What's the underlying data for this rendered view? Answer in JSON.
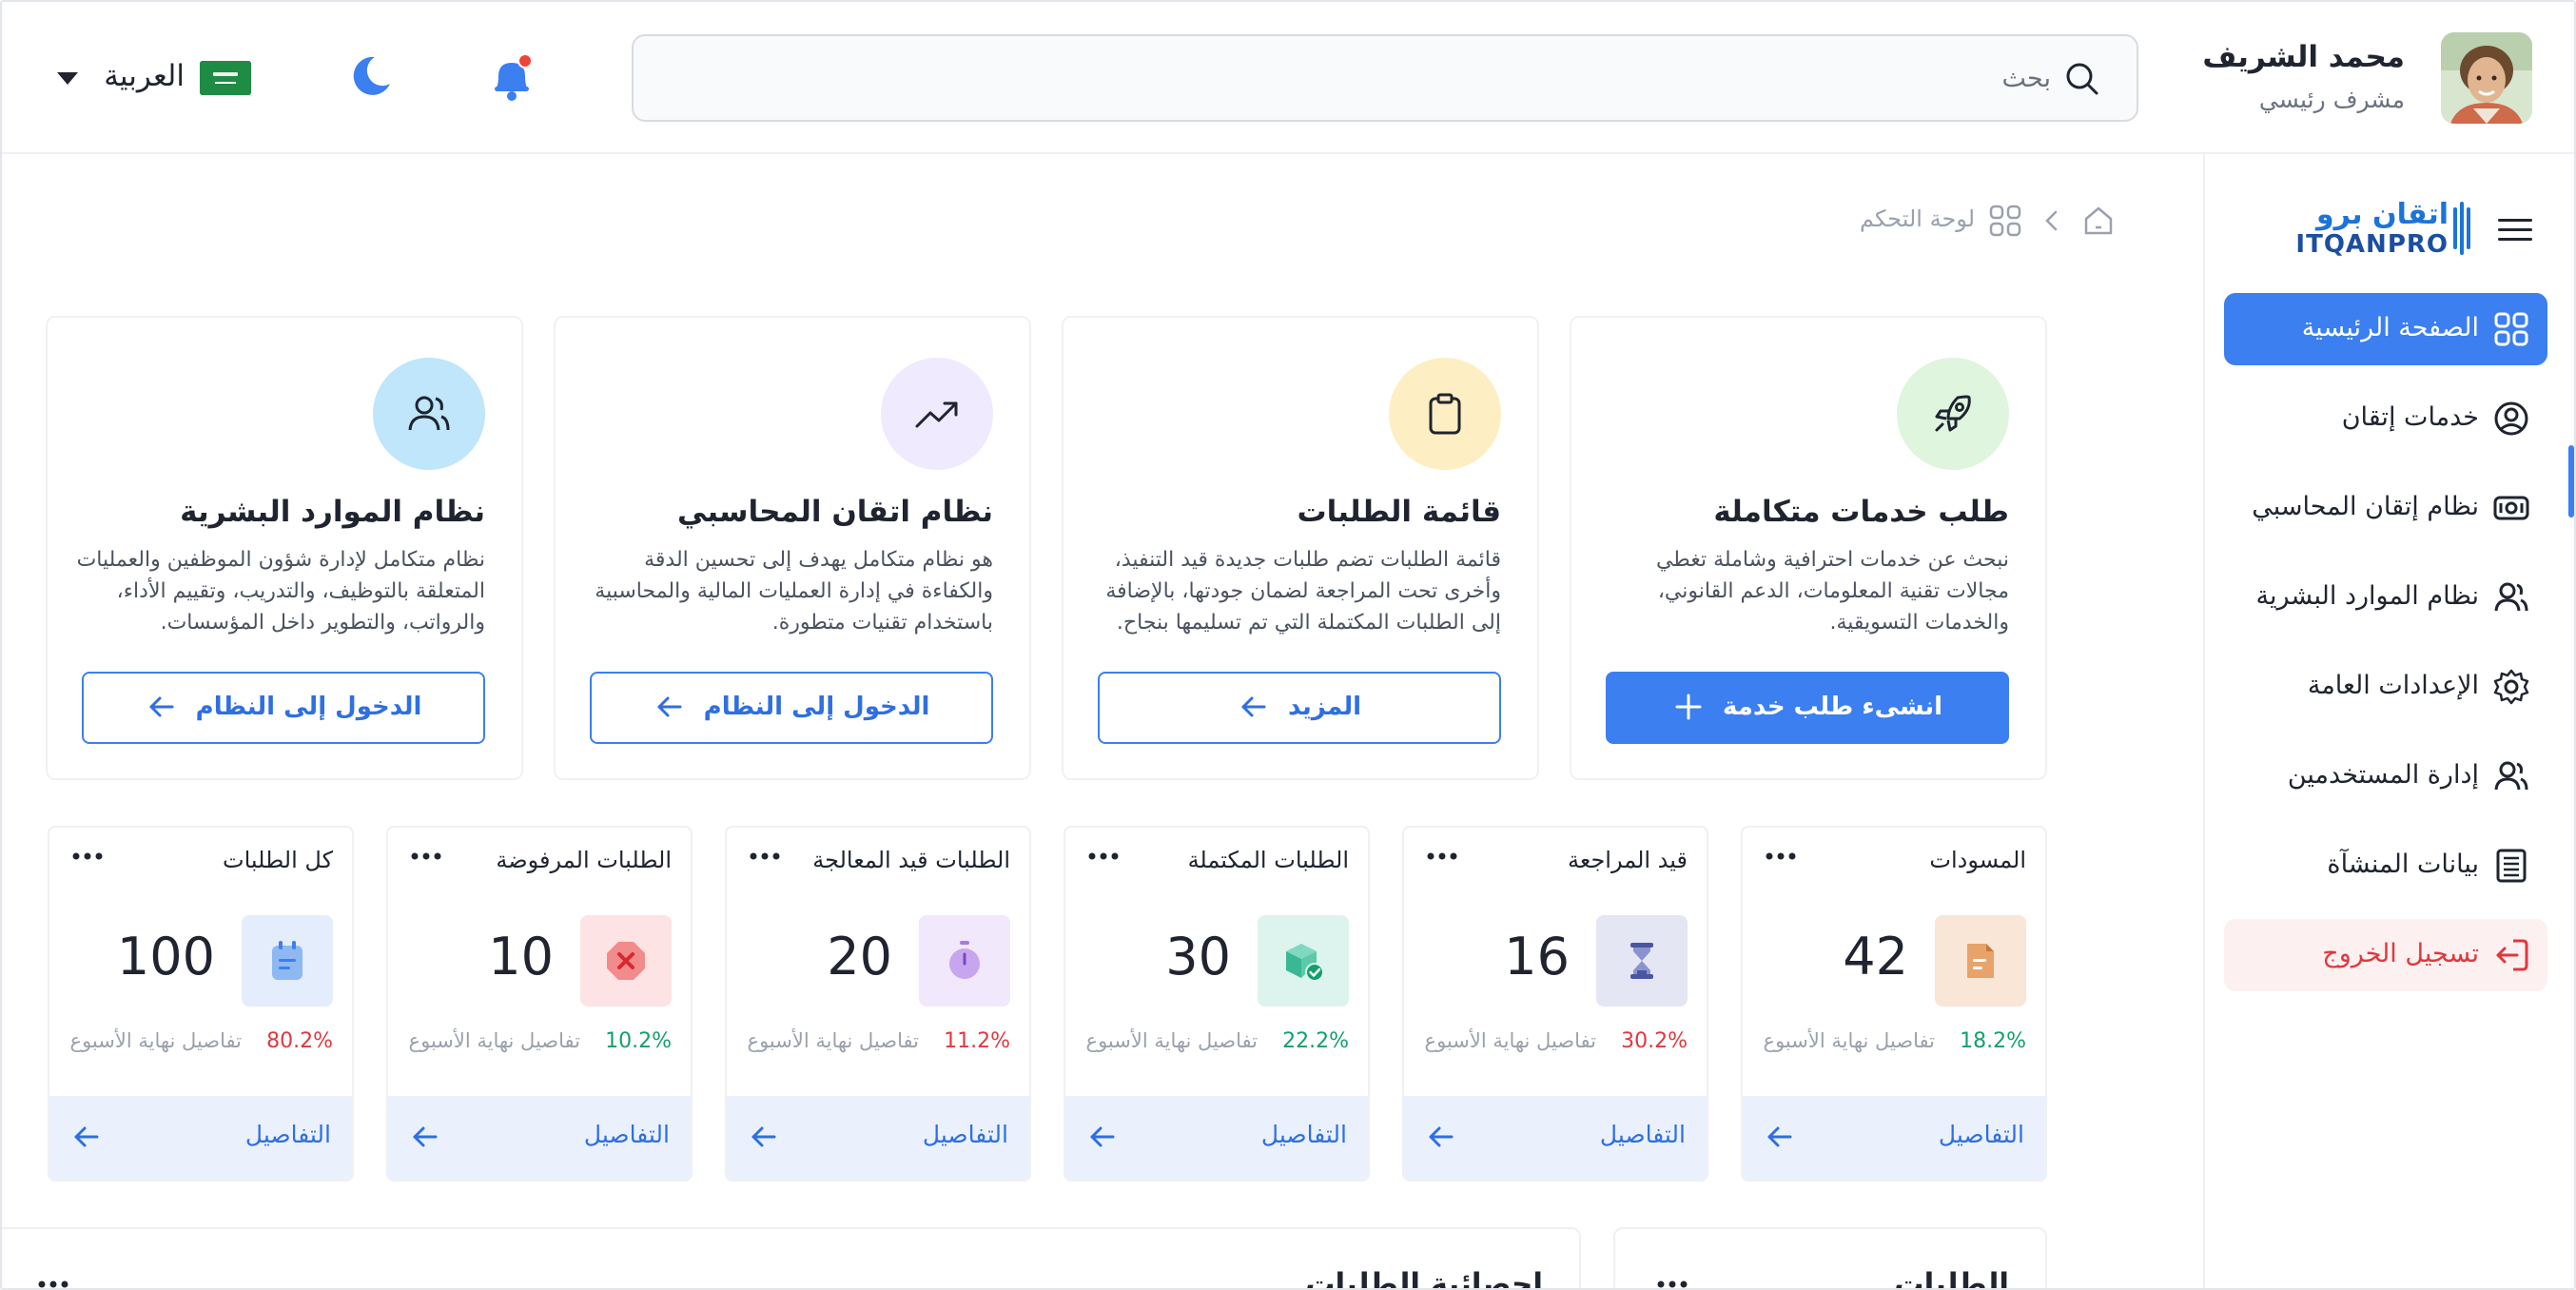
{
  "header": {
    "user_name": "محمد الشريف",
    "user_role": "مشرف رئيسي",
    "search_placeholder": "بحث",
    "search_value": "",
    "language_label": "العربية",
    "notification_dot_color": "#f04438"
  },
  "sidebar": {
    "brand_arabic": "اتقان برو",
    "brand_english": "ITQANPRO",
    "items": [
      {
        "label": "الصفحة الرئيسية",
        "icon": "grid-icon",
        "active": true
      },
      {
        "label": "خدمات إتقان",
        "icon": "user-circle-icon",
        "active": false
      },
      {
        "label": "نظام إتقان المحاسبي",
        "icon": "money-icon",
        "active": false
      },
      {
        "label": "نظام الموارد البشرية",
        "icon": "users-icon",
        "active": false
      },
      {
        "label": "الإعدادات العامة",
        "icon": "gear-icon",
        "active": false
      },
      {
        "label": "إدارة المستخدمين",
        "icon": "users-icon",
        "active": false
      },
      {
        "label": "بيانات المنشآة",
        "icon": "building-icon",
        "active": false
      }
    ],
    "logout_label": "تسجيل الخروج"
  },
  "breadcrumb": {
    "current": "لوحة التحكم"
  },
  "feature_cards": [
    {
      "title": "طلب خدمات متكاملة",
      "description": "نبحث عن خدمات احترافية وشاملة تغطي مجالات تقنية المعلومات، الدعم القانوني، والخدمات التسويقية.",
      "button_label": "انشىء طلب خدمة",
      "icon": "rocket-icon",
      "circle_color": "#dff5dd"
    },
    {
      "title": "قائمة الطلبات",
      "description": "قائمة الطلبات تضم طلبات جديدة قيد التنفيذ، وأخرى تحت المراجعة لضمان جودتها، بالإضافة إلى الطلبات المكتملة التي تم تسليمها بنجاح.",
      "button_label": "المزيد",
      "icon": "clipboard-icon",
      "circle_color": "#fdefc3"
    },
    {
      "title": "نظام اتقان المحاسبي",
      "description": "هو نظام متكامل يهدف إلى تحسين الدقة والكفاءة في إدارة العمليات المالية والمحاسبية باستخدام تقنيات متطورة.",
      "button_label": "الدخول إلى النظام",
      "icon": "trend-up-icon",
      "circle_color": "#efeafd"
    },
    {
      "title": "نظام الموارد البشرية",
      "description": "نظام متكامل لإدارة شؤون الموظفين والعمليات المتعلقة بالتوظيف، والتدريب، وتقييم الأداء، والرواتب، والتطوير داخل المؤسسات.",
      "button_label": "الدخول إلى النظام",
      "icon": "users-icon",
      "circle_color": "#bfe6fb"
    }
  ],
  "stat_cards": [
    {
      "title": "المسودات",
      "value": "42",
      "percent": "18.2%",
      "trend": "up",
      "sub": "تفاصيل نهاية الأسبوع",
      "footer": "التفاصيل",
      "icon": "document-icon",
      "box_color": "#f9e6d6"
    },
    {
      "title": "قيد المراجعة",
      "value": "16",
      "percent": "30.2%",
      "trend": "down",
      "sub": "تفاصيل نهاية الأسبوع",
      "footer": "التفاصيل",
      "icon": "hourglass-icon",
      "box_color": "#e4e6f4"
    },
    {
      "title": "الطلبات المكتملة",
      "value": "30",
      "percent": "22.2%",
      "trend": "up",
      "sub": "تفاصيل نهاية الأسبوع",
      "footer": "التفاصيل",
      "icon": "box-check-icon",
      "box_color": "#ddf3ee"
    },
    {
      "title": "الطلبات قيد المعالجة",
      "value": "20",
      "percent": "11.2%",
      "trend": "down",
      "sub": "تفاصيل نهاية الأسبوع",
      "footer": "التفاصيل",
      "icon": "timer-icon",
      "box_color": "#f1e8fb"
    },
    {
      "title": "الطلبات المرفوضة",
      "value": "10",
      "percent": "10.2%",
      "trend": "up",
      "sub": "تفاصيل نهاية الأسبوع",
      "footer": "التفاصيل",
      "icon": "reject-icon",
      "box_color": "#fde3e3"
    },
    {
      "title": "كل الطلبات",
      "value": "100",
      "percent": "80.2%",
      "trend": "down",
      "sub": "تفاصيل نهاية الأسبوع",
      "footer": "التفاصيل",
      "icon": "notepad-icon",
      "box_color": "#e3edfb"
    }
  ],
  "bottom_cards": [
    {
      "title": "الطلبات"
    },
    {
      "title": "إحصائية الطلبات"
    }
  ],
  "colors": {
    "primary": "#3b7ff0",
    "positive": "#14a06b",
    "negative": "#e0383e",
    "logout_bg": "#fdf0f0"
  }
}
